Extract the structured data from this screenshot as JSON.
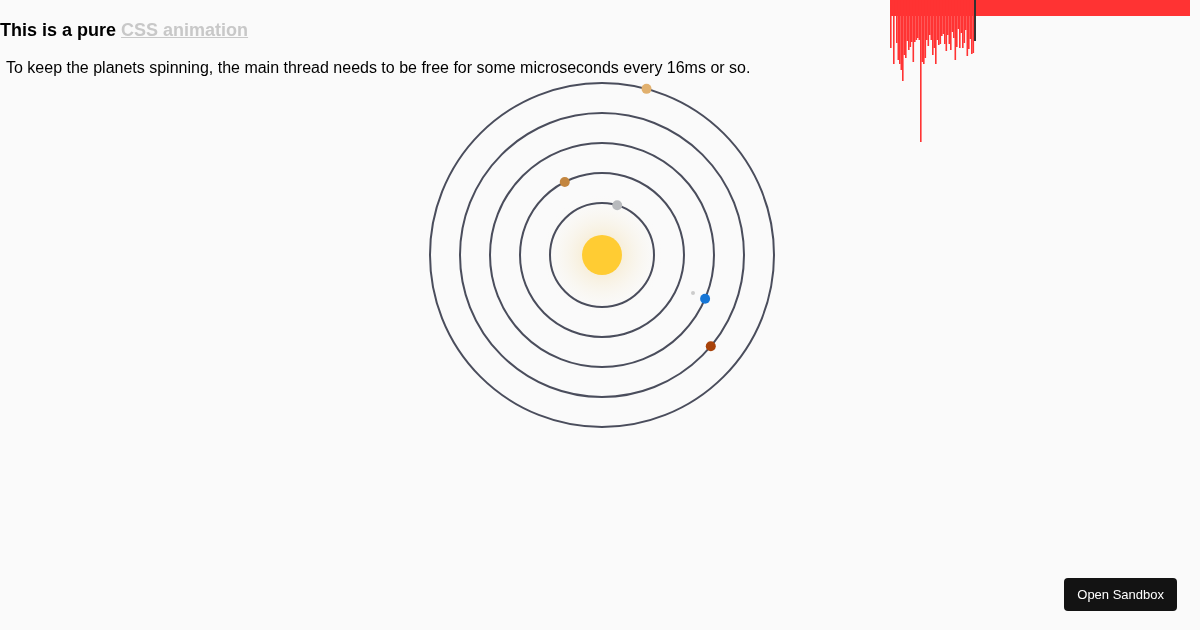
{
  "heading": {
    "text": "This is a pure",
    "link": "CSS animation"
  },
  "paragraph": "To keep the planets spinning, the main thread needs to be free for some microseconds every 16ms or so.",
  "solar_system": {
    "planets": [
      {
        "color": "#b8babd"
      },
      {
        "color": "#c38640"
      },
      {
        "color": "#1676d6"
      },
      {
        "color": "#a8420a"
      },
      {
        "color": "#e1b06e"
      }
    ]
  },
  "button": {
    "label": "Open Sandbox"
  }
}
